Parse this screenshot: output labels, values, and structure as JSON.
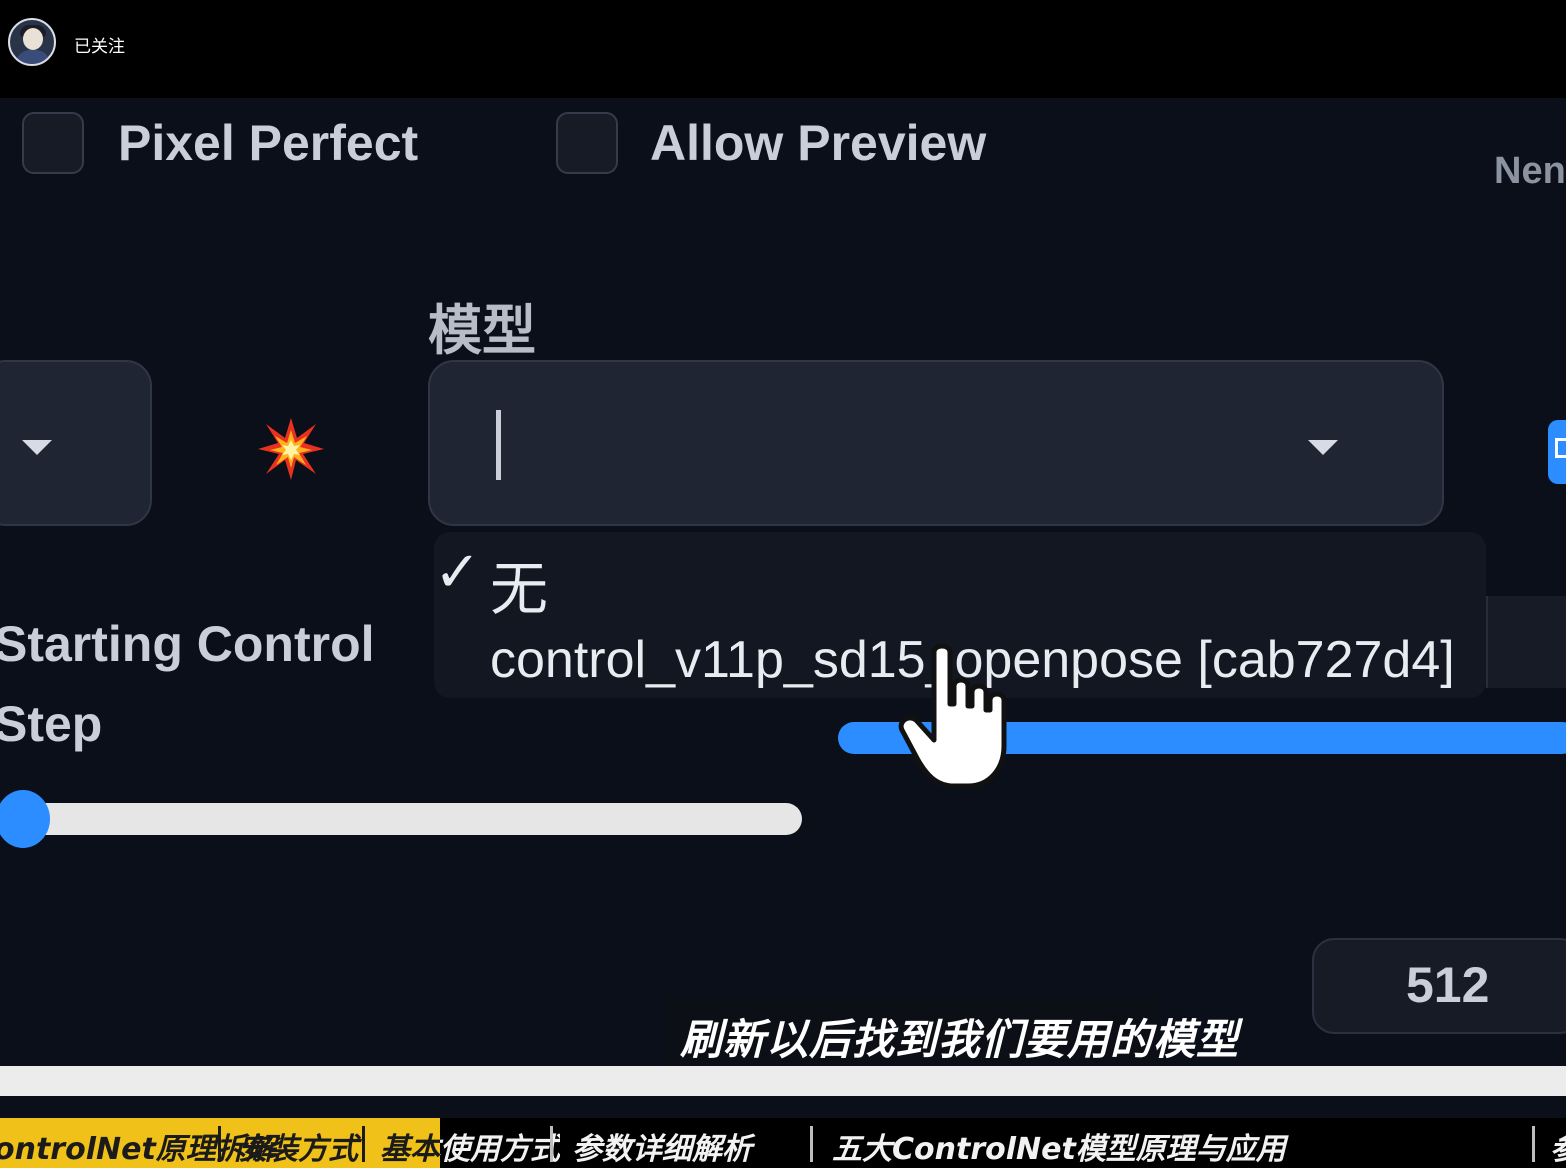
{
  "header": {
    "follow_status": "已关注"
  },
  "options": {
    "pixel_perfect": "Pixel Perfect",
    "allow_preview": "Allow Preview",
    "right_clip": "Nen"
  },
  "model": {
    "label": "模型",
    "dropdown_options": [
      {
        "label": "无",
        "selected": true,
        "check": "✓"
      },
      {
        "label": "control_v11p_sd15_openpose [cab727d4]",
        "selected": false
      }
    ]
  },
  "starting_control_step": {
    "label": "Starting Control Step"
  },
  "number_field": {
    "value": "512"
  },
  "subtitle": "刷新以后找到我们要用的模型",
  "chapters": [
    {
      "label": "ontrolNet原理拆解"
    },
    {
      "label": "安装方式"
    },
    {
      "label": "基本使用方式"
    },
    {
      "label": "参数详细解析"
    },
    {
      "label": "五大ControlNet模型原理与应用"
    },
    {
      "label": "参"
    }
  ],
  "colors": {
    "accent": "#2b8dff",
    "chapter_highlight": "#f0c118",
    "background": "#0b0f19"
  }
}
